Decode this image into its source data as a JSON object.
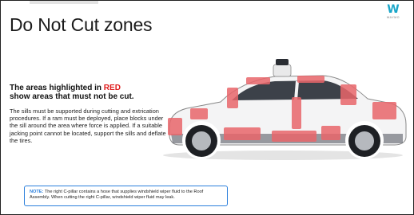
{
  "slide": {
    "title": "Do Not Cut zones",
    "subhead_part1": "The areas highlighted in ",
    "subhead_red": "RED",
    "subhead_part2": "show areas that must not be cut.",
    "body": "The sills must be supported during cutting and extrication procedures. If a ram must be deployed, place blocks under the sill around the area where force is applied. If a suitable jacking point cannot be located, support the sills and deflate the tires.",
    "note_label": "NOTE:",
    "note_text": " The right C-pillar contains a hose that supplies windshield wiper fluid to the Roof Assembly. When cutting the right C-pillar, windshield wiper fluid may leak."
  },
  "logo": {
    "mark": "W",
    "word": "WAYMO",
    "icon": "waymo-logo-icon"
  },
  "colors": {
    "accent_red": "#e01b1b",
    "note_blue": "#2b7fdc",
    "logo_teal": "#1aa6c9",
    "zone_red": "#e9666b"
  },
  "image": {
    "subject": "vehicle-side-view-icon"
  }
}
